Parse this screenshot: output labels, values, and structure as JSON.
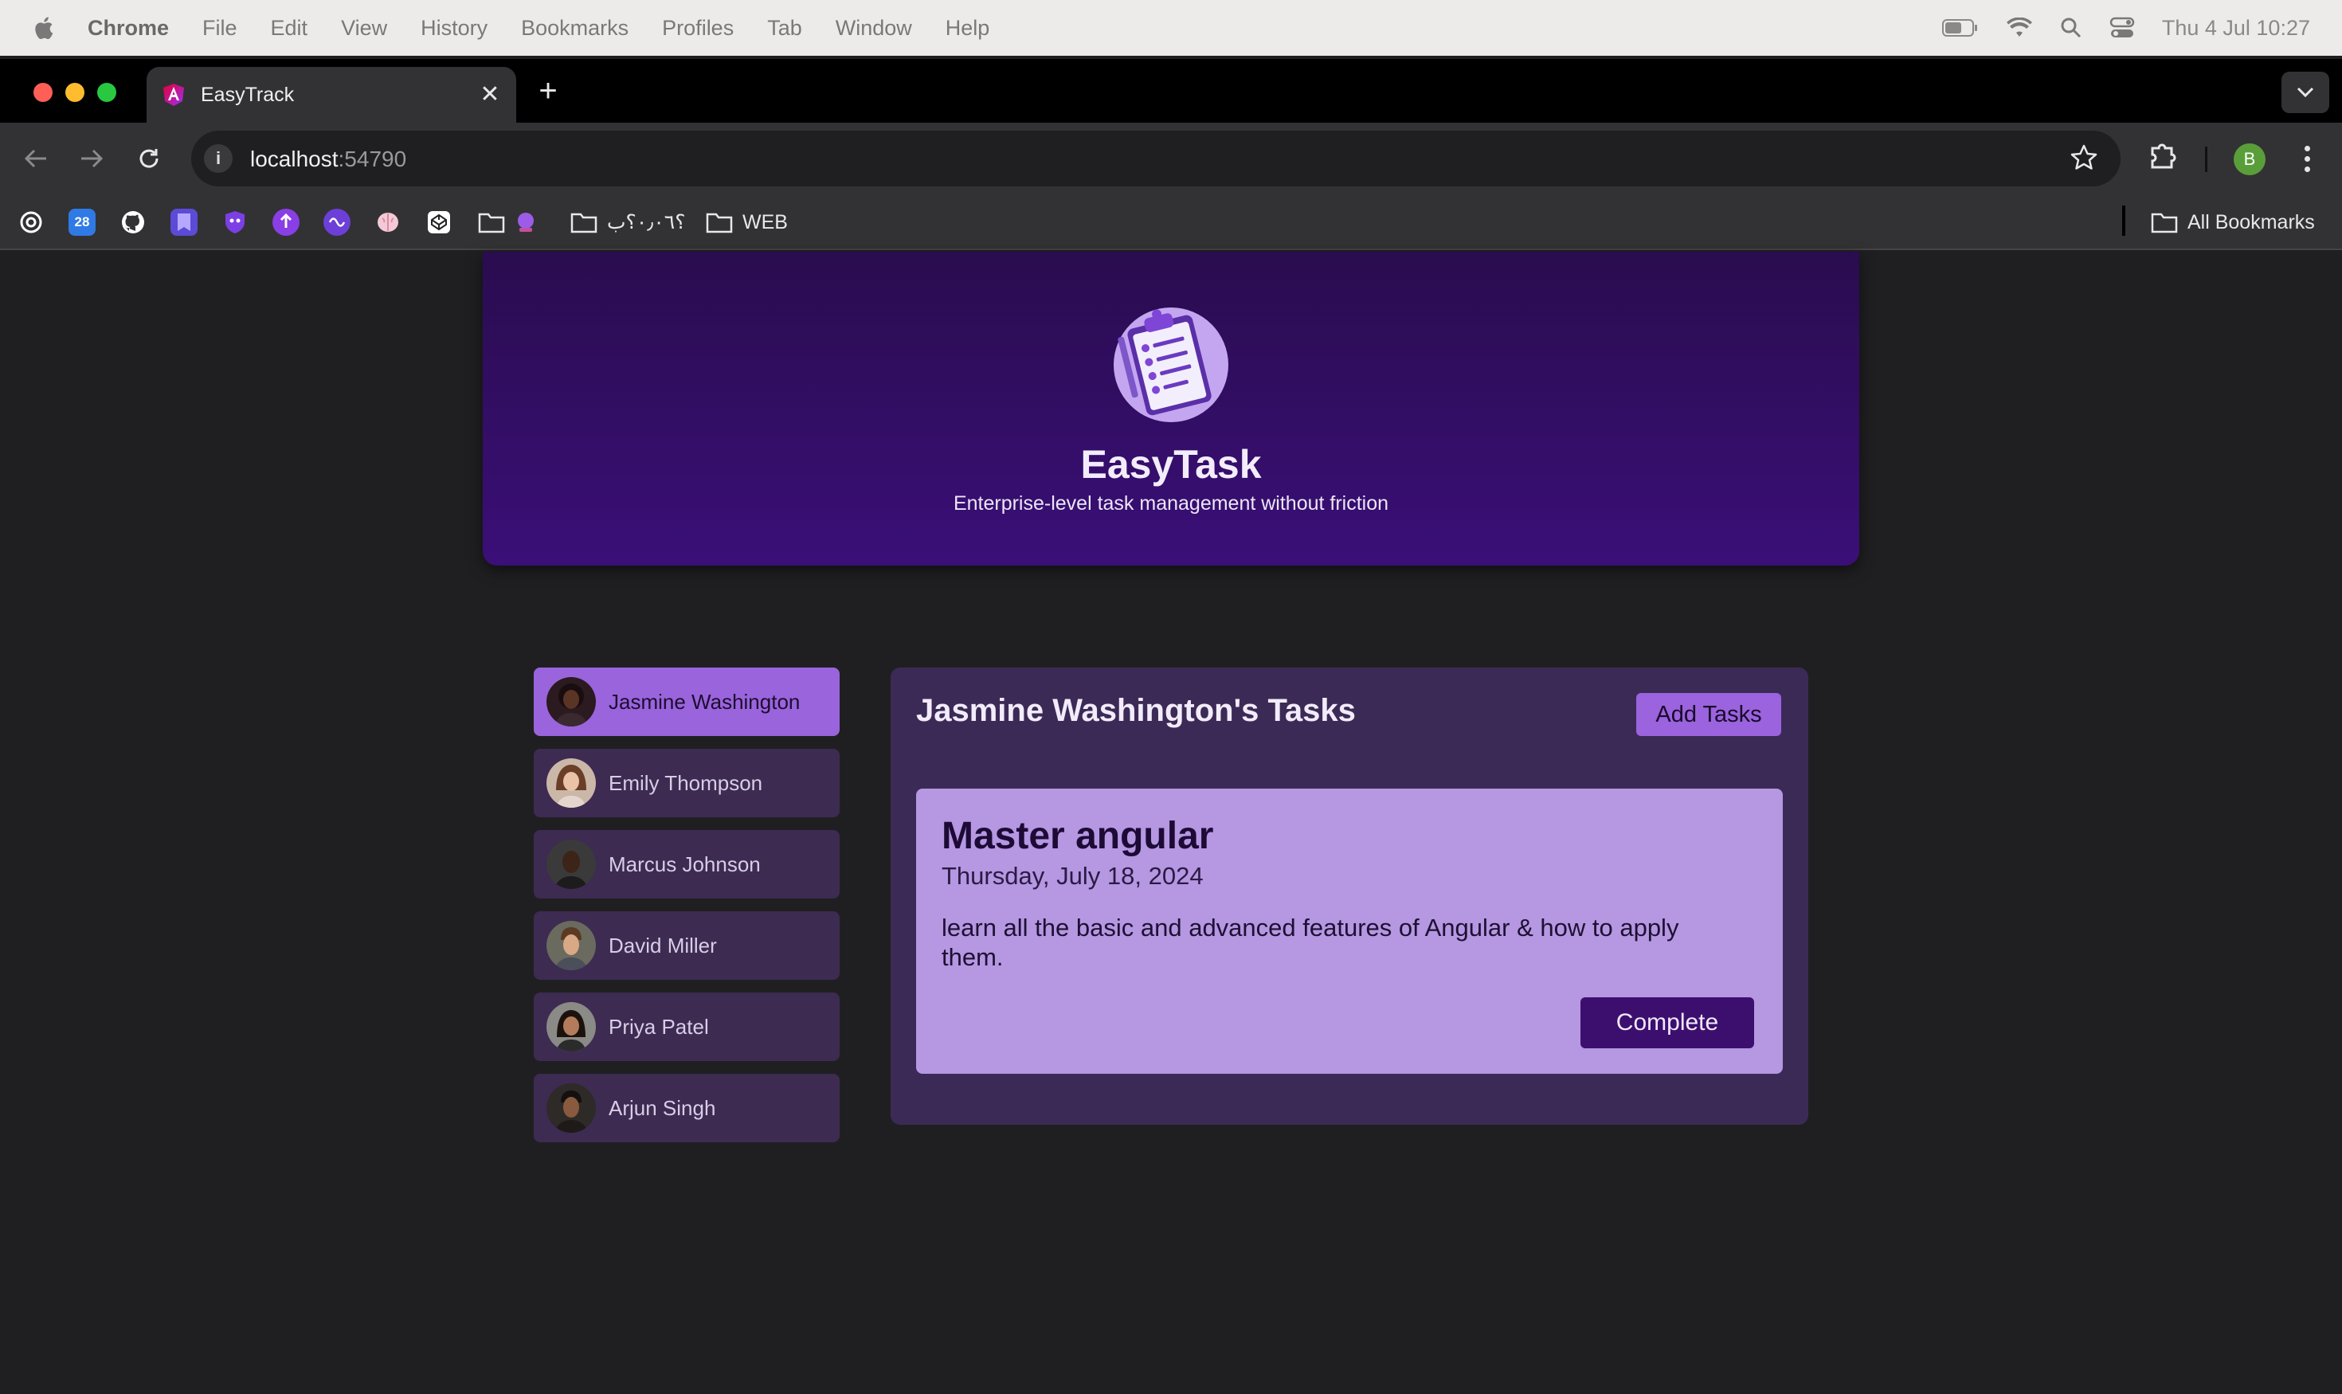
{
  "menubar": {
    "app": "Chrome",
    "items": [
      "File",
      "Edit",
      "View",
      "History",
      "Bookmarks",
      "Profiles",
      "Tab",
      "Window",
      "Help"
    ],
    "datetime": "Thu 4 Jul  10:27",
    "icons": [
      "battery-icon",
      "wifi-icon",
      "spotlight-search-icon",
      "control-center-icon"
    ]
  },
  "browser": {
    "tab_title": "EasyTrack",
    "url_host": "localhost",
    "url_port": ":54790",
    "profile_initial": "B"
  },
  "bookmarks": {
    "icons": [
      "chatgpt-icon",
      "calendar-icon",
      "github-icon",
      "bookmark-app-icon",
      "shield-app-icon",
      "upload-app-icon",
      "app-icon",
      "brain-icon",
      "codepen-icon"
    ],
    "calendar_label": "28",
    "folders": [
      "",
      "؟٠٫٠٦؟ب",
      "WEB"
    ],
    "all_bookmarks": "All Bookmarks"
  },
  "app": {
    "title": "EasyTask",
    "subtitle": "Enterprise-level task management without friction"
  },
  "users": [
    {
      "name": "Jasmine Washington",
      "active": true
    },
    {
      "name": "Emily Thompson",
      "active": false
    },
    {
      "name": "Marcus Johnson",
      "active": false
    },
    {
      "name": "David Miller",
      "active": false
    },
    {
      "name": "Priya Patel",
      "active": false
    },
    {
      "name": "Arjun Singh",
      "active": false
    }
  ],
  "tasks": {
    "heading": "Jasmine Washington's Tasks",
    "add_label": "Add Tasks",
    "items": [
      {
        "title": "Master angular",
        "date": "Thursday, July 18, 2024",
        "description": "learn all the basic and advanced features of Angular & how to apply them.",
        "complete_label": "Complete"
      }
    ]
  },
  "colors": {
    "accent": "#9b63dd",
    "banner_top": "#2a0c4f",
    "banner_bottom": "#3a0f78",
    "panel": "#3c2a56",
    "card": "#b597e2",
    "complete_button": "#3c0f6f"
  }
}
